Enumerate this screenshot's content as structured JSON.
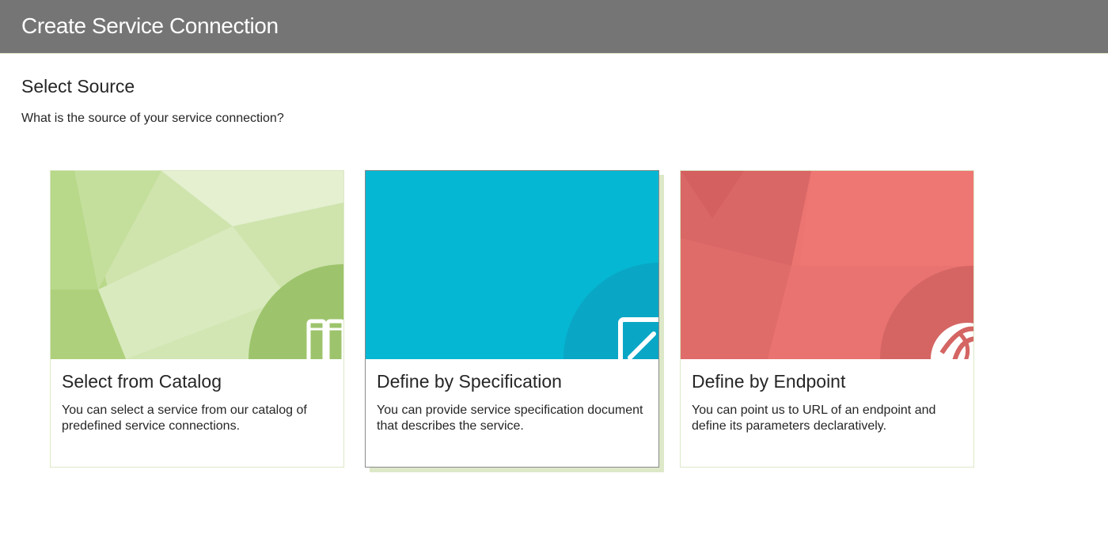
{
  "header": {
    "title": "Create Service Connection"
  },
  "main": {
    "section_title": "Select Source",
    "section_subtitle": "What is the source of your service connection?"
  },
  "cards": [
    {
      "title": "Select from Catalog",
      "description": "You can select a service from our catalog of predefined service connections.",
      "icon": "catalog-icon",
      "color": "#cfe3a8",
      "selected": false
    },
    {
      "title": "Define by Specification",
      "description": "You can provide service specification document that describes the service.",
      "icon": "edit-document-icon",
      "color": "#05b7d2",
      "selected": true
    },
    {
      "title": "Define by Endpoint",
      "description": "You can point us to URL of an endpoint and define its parameters declaratively.",
      "icon": "endpoint-globe-icon",
      "color": "#e87370",
      "selected": false
    }
  ],
  "colors": {
    "header_bg": "#757575",
    "card_border": "#dbe8c6",
    "selected_shadow": "#dde8c8"
  }
}
